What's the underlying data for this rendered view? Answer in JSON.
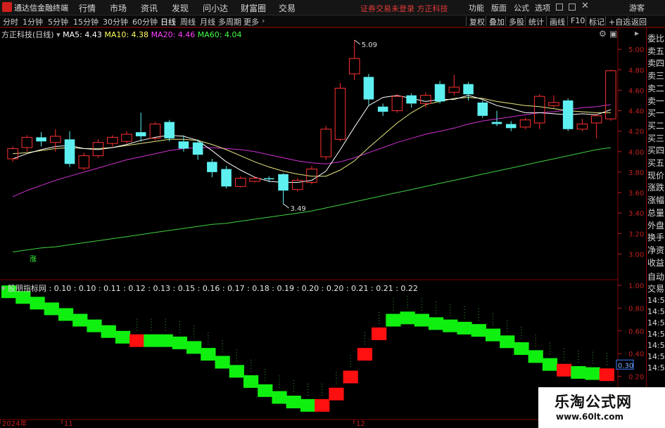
{
  "titlebar": {
    "app_name": "通达信金融终端",
    "menus": [
      "行情",
      "市场",
      "资讯",
      "发现",
      "问小达",
      "财富圈",
      "交易"
    ],
    "notice": "证券交易未登录 方正科技",
    "right_menus": [
      "功能",
      "版面",
      "公式",
      "选项"
    ],
    "guest": "游客"
  },
  "toolbar": {
    "periods": [
      "分时",
      "1分钟",
      "5分钟",
      "15分钟",
      "30分钟",
      "60分钟",
      "日线",
      "周线",
      "月线",
      "多周期",
      "更多"
    ],
    "active_period": "日线",
    "buttons": [
      "复权",
      "叠加",
      "多股",
      "统计",
      "画线",
      "F10",
      "标记",
      "+自选",
      "返回"
    ]
  },
  "main_chart": {
    "stock_label": "方正科技(日线)",
    "ma": [
      {
        "label": "MA5: 4.43",
        "color": "#ffffff"
      },
      {
        "label": "MA10: 4.38",
        "color": "#ffff60"
      },
      {
        "label": "MA20: 4.46",
        "color": "#ff40ff"
      },
      {
        "label": "MA60: 4.04",
        "color": "#40ff40"
      }
    ],
    "high_marker": "5.09",
    "low_marker": "3.49",
    "axis_label": "涨"
  },
  "chart_data": [
    {
      "type": "candlestick",
      "name": "方正科技(日线)",
      "ylim": [
        2.9,
        5.2
      ],
      "yticks": [
        5.0,
        4.8,
        4.6,
        4.4,
        4.2,
        4.0,
        3.8,
        3.6,
        3.4,
        3.2,
        3.0
      ],
      "candles": [
        {
          "o": 3.93,
          "c": 4.03,
          "h": 4.05,
          "l": 3.9
        },
        {
          "o": 4.04,
          "c": 4.14,
          "h": 4.16,
          "l": 4.0
        },
        {
          "o": 4.14,
          "c": 4.1,
          "h": 4.19,
          "l": 4.05
        },
        {
          "o": 4.09,
          "c": 4.15,
          "h": 4.22,
          "l": 4.0
        },
        {
          "o": 4.12,
          "c": 3.88,
          "h": 4.2,
          "l": 3.85
        },
        {
          "o": 3.84,
          "c": 3.96,
          "h": 3.99,
          "l": 3.82
        },
        {
          "o": 3.96,
          "c": 4.09,
          "h": 4.12,
          "l": 3.94
        },
        {
          "o": 4.08,
          "c": 4.14,
          "h": 4.16,
          "l": 4.05
        },
        {
          "o": 4.1,
          "c": 4.17,
          "h": 4.2,
          "l": 4.08
        },
        {
          "o": 4.19,
          "c": 4.15,
          "h": 4.38,
          "l": 4.1
        },
        {
          "o": 4.13,
          "c": 4.27,
          "h": 4.29,
          "l": 4.11
        },
        {
          "o": 4.29,
          "c": 4.13,
          "h": 4.31,
          "l": 4.1
        },
        {
          "o": 4.1,
          "c": 4.03,
          "h": 4.16,
          "l": 4.0
        },
        {
          "o": 4.09,
          "c": 3.97,
          "h": 4.12,
          "l": 3.92
        },
        {
          "o": 3.9,
          "c": 3.8,
          "h": 3.93,
          "l": 3.75
        },
        {
          "o": 3.83,
          "c": 3.66,
          "h": 3.86,
          "l": 3.64
        },
        {
          "o": 3.66,
          "c": 3.74,
          "h": 3.76,
          "l": 3.65
        },
        {
          "o": 3.71,
          "c": 3.74,
          "h": 3.76,
          "l": 3.7
        },
        {
          "o": 3.74,
          "c": 3.73,
          "h": 3.76,
          "l": 3.7
        },
        {
          "o": 3.78,
          "c": 3.62,
          "h": 3.79,
          "l": 3.49
        },
        {
          "o": 3.63,
          "c": 3.72,
          "h": 3.74,
          "l": 3.61
        },
        {
          "o": 3.7,
          "c": 3.83,
          "h": 3.86,
          "l": 3.68
        },
        {
          "o": 3.95,
          "c": 4.22,
          "h": 4.25,
          "l": 3.92
        },
        {
          "o": 4.12,
          "c": 4.62,
          "h": 4.67,
          "l": 4.1
        },
        {
          "o": 4.76,
          "c": 4.91,
          "h": 5.09,
          "l": 4.7
        },
        {
          "o": 4.73,
          "c": 4.51,
          "h": 4.76,
          "l": 4.45
        },
        {
          "o": 4.44,
          "c": 4.39,
          "h": 4.47,
          "l": 4.35
        },
        {
          "o": 4.4,
          "c": 4.54,
          "h": 4.56,
          "l": 4.38
        },
        {
          "o": 4.55,
          "c": 4.47,
          "h": 4.57,
          "l": 4.43
        },
        {
          "o": 4.47,
          "c": 4.55,
          "h": 4.58,
          "l": 4.43
        },
        {
          "o": 4.66,
          "c": 4.49,
          "h": 4.69,
          "l": 4.47
        },
        {
          "o": 4.58,
          "c": 4.63,
          "h": 4.75,
          "l": 4.55
        },
        {
          "o": 4.66,
          "c": 4.56,
          "h": 4.68,
          "l": 4.5
        },
        {
          "o": 4.48,
          "c": 4.35,
          "h": 4.5,
          "l": 4.33
        },
        {
          "o": 4.29,
          "c": 4.27,
          "h": 4.4,
          "l": 4.25
        },
        {
          "o": 4.27,
          "c": 4.23,
          "h": 4.3,
          "l": 4.2
        },
        {
          "o": 4.24,
          "c": 4.31,
          "h": 4.33,
          "l": 4.22
        },
        {
          "o": 4.28,
          "c": 4.54,
          "h": 4.56,
          "l": 4.22
        },
        {
          "o": 4.45,
          "c": 4.48,
          "h": 4.55,
          "l": 4.43
        },
        {
          "o": 4.5,
          "c": 4.22,
          "h": 4.52,
          "l": 4.2
        },
        {
          "o": 4.22,
          "c": 4.27,
          "h": 4.32,
          "l": 4.2
        },
        {
          "o": 4.28,
          "c": 4.35,
          "h": 4.37,
          "l": 4.13
        },
        {
          "o": 4.32,
          "c": 4.79,
          "h": 4.8,
          "l": 4.3
        }
      ],
      "ma5": [
        3.93,
        3.98,
        4.02,
        4.05,
        4.06,
        4.03,
        4.02,
        4.04,
        4.07,
        4.11,
        4.14,
        4.16,
        4.15,
        4.11,
        4.01,
        3.9,
        3.82,
        3.75,
        3.71,
        3.7,
        3.7,
        3.72,
        3.81,
        4.02,
        4.24,
        4.45,
        4.53,
        4.55,
        4.52,
        4.49,
        4.51,
        4.51,
        4.55,
        4.51,
        4.45,
        4.42,
        4.38,
        4.38,
        4.37,
        4.36,
        4.37,
        4.36,
        4.41
      ],
      "ma10": [
        3.98,
        3.99,
        4.01,
        4.03,
        4.04,
        4.03,
        4.03,
        4.04,
        4.06,
        4.08,
        4.1,
        4.12,
        4.12,
        4.11,
        4.07,
        4.02,
        3.96,
        3.9,
        3.85,
        3.81,
        3.78,
        3.76,
        3.76,
        3.82,
        3.91,
        4.04,
        4.16,
        4.28,
        4.38,
        4.46,
        4.49,
        4.52,
        4.53,
        4.52,
        4.49,
        4.47,
        4.45,
        4.44,
        4.42,
        4.4,
        4.39,
        4.38,
        4.38
      ],
      "ma20": [
        3.56,
        3.62,
        3.67,
        3.72,
        3.76,
        3.8,
        3.84,
        3.88,
        3.92,
        3.95,
        3.98,
        4.01,
        4.03,
        4.04,
        4.04,
        4.03,
        4.02,
        4.0,
        3.97,
        3.94,
        3.91,
        3.89,
        3.88,
        3.9,
        3.94,
        3.99,
        4.04,
        4.09,
        4.13,
        4.17,
        4.2,
        4.23,
        4.27,
        4.3,
        4.32,
        4.34,
        4.36,
        4.38,
        4.39,
        4.41,
        4.43,
        4.44,
        4.46
      ],
      "ma60": [
        3.02,
        3.04,
        3.06,
        3.07,
        3.09,
        3.11,
        3.13,
        3.15,
        3.17,
        3.19,
        3.21,
        3.23,
        3.25,
        3.27,
        3.29,
        3.3,
        3.32,
        3.34,
        3.36,
        3.38,
        3.4,
        3.42,
        3.45,
        3.48,
        3.51,
        3.54,
        3.57,
        3.6,
        3.63,
        3.66,
        3.69,
        3.72,
        3.75,
        3.78,
        3.81,
        3.84,
        3.87,
        3.9,
        3.93,
        3.96,
        3.99,
        4.02,
        4.04
      ]
    },
    {
      "type": "area",
      "name": "股朋指标网",
      "legend_values": [
        "0.10",
        "0.10",
        "0.11",
        "0.12",
        "0.13",
        "0.15",
        "0.16",
        "0.17",
        "0.18",
        "0.19",
        "0.20",
        "0.20",
        "0.21",
        "0.21",
        "0.22"
      ],
      "ylim": [
        -0.15,
        1.05
      ],
      "yticks": [
        1.0,
        0.8,
        0.6,
        0.4,
        0.2
      ],
      "current_value": "0.30",
      "values": [
        0.95,
        0.9,
        0.85,
        0.8,
        0.75,
        0.7,
        0.65,
        0.6,
        0.55,
        0.52,
        0.52,
        0.52,
        0.5,
        0.46,
        0.4,
        0.33,
        0.25,
        0.16,
        0.08,
        0.02,
        -0.02,
        -0.05,
        -0.05,
        0.05,
        0.2,
        0.4,
        0.58,
        0.7,
        0.72,
        0.7,
        0.67,
        0.65,
        0.63,
        0.61,
        0.57,
        0.51,
        0.45,
        0.38,
        0.31,
        0.26,
        0.24,
        0.23,
        0.22
      ],
      "red": [
        false,
        false,
        false,
        false,
        false,
        false,
        false,
        false,
        false,
        true,
        false,
        false,
        false,
        false,
        false,
        false,
        false,
        false,
        false,
        false,
        false,
        false,
        true,
        true,
        true,
        true,
        true,
        false,
        false,
        false,
        false,
        false,
        false,
        false,
        false,
        false,
        false,
        false,
        false,
        true,
        false,
        false,
        true
      ]
    }
  ],
  "right_panel": {
    "items": [
      "委比",
      "卖五",
      "卖四",
      "卖三",
      "卖二",
      "卖一",
      "买一",
      "买二",
      "买三",
      "买四",
      "买五",
      "现价",
      "涨跌",
      "涨幅",
      "总量",
      "外盘",
      "换手",
      "净资",
      "收益",
      "自动",
      "交易"
    ],
    "times": [
      "14:56",
      "14:56",
      "14:56",
      "14:56",
      "14:56",
      "14:56",
      "14:56"
    ]
  },
  "xaxis": {
    "labels": [
      "2024年",
      "11",
      "12"
    ]
  },
  "watermark": {
    "title": "乐淘公式网",
    "url": "www.60lt.com"
  }
}
